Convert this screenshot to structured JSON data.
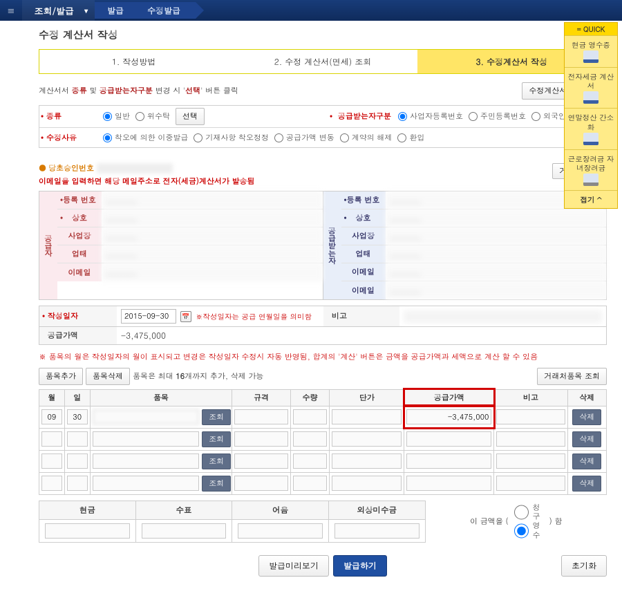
{
  "topbar": {
    "menu_icon": "≡",
    "dropdown": "조회/발급",
    "crumbs": [
      "발급",
      "수정발급"
    ]
  },
  "page_title": "수정 계산서 작성",
  "steps": {
    "items": [
      "1. 작성방법",
      "2. 수정 계산서(면세) 조회",
      "3. 수정계산서 작성"
    ],
    "active": 2
  },
  "help_line": {
    "pre": "계산서서 ",
    "b1": "종류",
    "mid": " 및 ",
    "b2": "공급받는자구분",
    "post": " 변경 시 '",
    "sel": "선택",
    "post2": "' 버튼 클릭"
  },
  "btn_issue_method": "수정계산서 발급방법",
  "form": {
    "kind_label": "종류",
    "kind_opts": [
      "일반",
      "위수탁"
    ],
    "select_btn": "선택",
    "recipient_label": "공급받는자구분",
    "recipient_opts": [
      "사업자등록번호",
      "주민등록번호",
      "외국인"
    ],
    "reason_label": "수정사유",
    "reasons": [
      "착오에 의한 이중발급",
      "기재사항 착오정정",
      "공급가액 변동",
      "계약의 해제",
      "환입"
    ]
  },
  "approval": {
    "label": "당초승인번호"
  },
  "email_note": "이메일을 입력하면 해당 메일주소로 전자(세금)계산서가 발송됨",
  "lookup_partner": "거래처 조회",
  "party": {
    "seller_hd": "공급자",
    "buyer_hd": "공급받는자",
    "labels": {
      "reg": "등록\n번호",
      "name": "상호",
      "addr": "사업장",
      "btype": "업태",
      "email": "이메일"
    }
  },
  "lower_form": {
    "date_label": "작성일자",
    "date_value": "2015-09-30",
    "date_note": "※작성일자는 공급 연월일을 의미함",
    "remark_label": "비고",
    "supply_sum_label": "공급가액",
    "supply_sum_value": "-3,475,000"
  },
  "items_note": "※ 품목의 월은 작성일자의 월이 표시되고 변경은 작성일자 수정시 자동 반영됨, 합계의 '계산' 버튼은 금액을 공급가액과 세액으로 계산 할 수 있음",
  "item_add": "품목추가",
  "item_del": "품목삭제",
  "item_limit_pre": "품목은 최대 ",
  "item_limit_n": "16",
  "item_limit_post": "개까지 추가, 삭제 가능",
  "item_lookup": "거래처품목 조회",
  "grid": {
    "headers": [
      "월",
      "일",
      "품목",
      "규격",
      "수량",
      "단가",
      "공급가액",
      "비고",
      "삭제"
    ],
    "rows": [
      {
        "m": "09",
        "d": "30",
        "item": "",
        "spec": "",
        "qty": "",
        "price": "",
        "supply": "-3,475,000",
        "note": ""
      },
      {
        "m": "",
        "d": "",
        "item": "",
        "spec": "",
        "qty": "",
        "price": "",
        "supply": "",
        "note": ""
      },
      {
        "m": "",
        "d": "",
        "item": "",
        "spec": "",
        "qty": "",
        "price": "",
        "supply": "",
        "note": ""
      },
      {
        "m": "",
        "d": "",
        "item": "",
        "spec": "",
        "qty": "",
        "price": "",
        "supply": "",
        "note": ""
      }
    ],
    "btn_search": "조회",
    "btn_delete": "삭제"
  },
  "summary": {
    "headers": [
      "현금",
      "수표",
      "어음",
      "외상미수금"
    ],
    "claim_label": "이 금액을 (",
    "claim_opts": [
      "청구",
      "영수"
    ],
    "claim_suffix": ") 함"
  },
  "actions": {
    "preview": "발급미리보기",
    "issue": "발급하기",
    "reset": "초기화"
  },
  "quick": {
    "title": "= QUICK",
    "items": [
      "현금\n영수증",
      "전자세금\n계산서",
      "연말정산\n간소화",
      "근로장려금\n자녀장려금"
    ],
    "foot": "접기 ^"
  }
}
